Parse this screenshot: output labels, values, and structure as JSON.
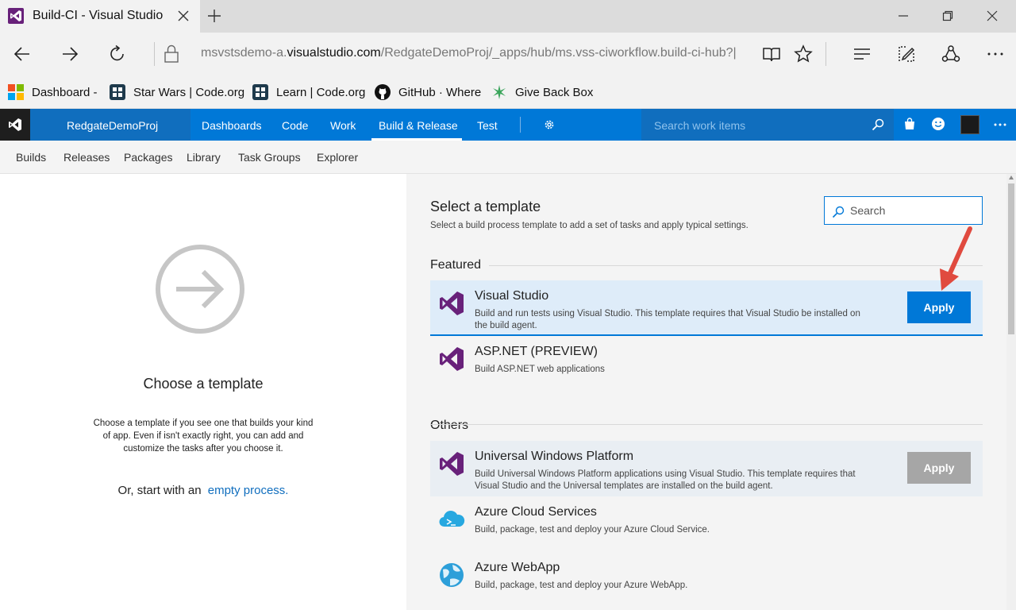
{
  "browser": {
    "tab_title": "Build-CI - Visual Studio",
    "url_prefix": "msvstsdemo-a.",
    "url_host": "visualstudio.com",
    "url_path": "/RedgateDemoProj/_apps/hub/ms.vss-ciworkflow.build-ci-hub?|",
    "favorites": [
      "Dashboard -",
      "Star Wars | Code.org",
      "Learn | Code.org",
      "GitHub · Where",
      "Give Back Box"
    ]
  },
  "vsts": {
    "project": "RedgateDemoProj",
    "nav": [
      "Dashboards",
      "Code",
      "Work",
      "Build & Release",
      "Test"
    ],
    "active_nav": "Build & Release",
    "search_placeholder": "Search work items",
    "subnav": [
      "Builds",
      "Releases",
      "Packages",
      "Library",
      "Task Groups",
      "Explorer"
    ],
    "accent": "#0078d7"
  },
  "left": {
    "title": "Choose a template",
    "description": "Choose a template if you see one that builds your kind of app. Even if isn't exactly right, you can add and customize the tasks after you choose it.",
    "or_start": "Or, start with an",
    "empty_link": "empty process."
  },
  "right": {
    "title": "Select a template",
    "subtitle": "Select a build process template to add a set of tasks and apply typical settings.",
    "search_placeholder": "Search",
    "featured_label": "Featured",
    "others_label": "Others",
    "featured": [
      {
        "name": "Visual Studio",
        "description": "Build and run tests using Visual Studio. This template requires that Visual Studio be installed on the build agent.",
        "icon": "visual-studio-icon",
        "apply": "Apply"
      },
      {
        "name": "ASP.NET (PREVIEW)",
        "description": "Build ASP.NET web applications",
        "icon": "visual-studio-icon"
      }
    ],
    "others": [
      {
        "name": "Universal Windows Platform",
        "description": "Build Universal Windows Platform applications using Visual Studio. This template requires that Visual Studio and the Universal templates are installed on the build agent.",
        "icon": "visual-studio-icon",
        "apply": "Apply"
      },
      {
        "name": "Azure Cloud Services",
        "description": "Build, package, test and deploy your Azure Cloud Service.",
        "icon": "cloud-icon"
      },
      {
        "name": "Azure WebApp",
        "description": "Build, package, test and deploy your Azure WebApp.",
        "icon": "globe-icon"
      }
    ]
  }
}
